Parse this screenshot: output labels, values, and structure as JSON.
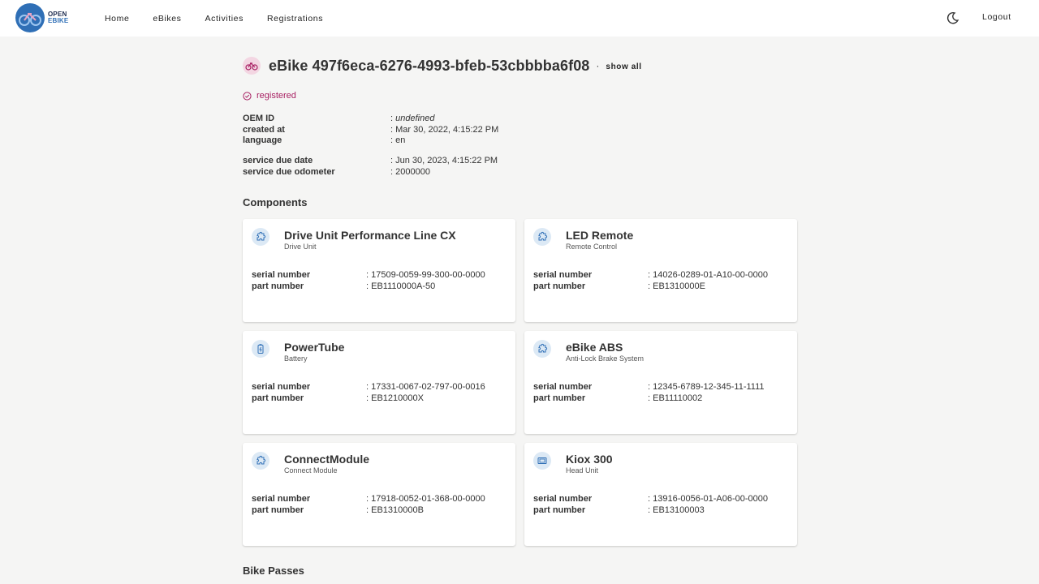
{
  "brand": {
    "line1": "OPEN",
    "line2": "EBIKE"
  },
  "nav": {
    "items": [
      {
        "label": "Home"
      },
      {
        "label": "eBikes"
      },
      {
        "label": "Activities"
      },
      {
        "label": "Registrations"
      }
    ]
  },
  "header": {
    "logout": "Logout"
  },
  "ebike": {
    "title": "eBike 497f6eca-6276-4993-bfeb-53cbbbba6f08",
    "separator": "·",
    "show_all": "show all",
    "status": "registered",
    "props1": [
      {
        "key": "OEM ID",
        "value": ": undefined"
      },
      {
        "key": "created at",
        "value": ": Mar 30, 2022, 4:15:22 PM"
      },
      {
        "key": "language",
        "value": ": en"
      }
    ],
    "props2": [
      {
        "key": "service due date",
        "value": ": Jun 30, 2023, 4:15:22 PM"
      },
      {
        "key": "service due odometer",
        "value": ": 2000000"
      }
    ]
  },
  "components_title": "Components",
  "components": [
    {
      "name": "Drive Unit Performance Line CX",
      "type": "Drive Unit",
      "icon": "puzzle-icon",
      "serial_label": "serial number",
      "serial": ": 17509-0059-99-300-00-0000",
      "part_label": "part number",
      "part": ": EB1110000A-50"
    },
    {
      "name": "LED Remote",
      "type": "Remote Control",
      "icon": "puzzle-icon",
      "serial_label": "serial number",
      "serial": ": 14026-0289-01-A10-00-0000",
      "part_label": "part number",
      "part": ": EB1310000E"
    },
    {
      "name": "PowerTube",
      "type": "Battery",
      "icon": "battery-icon",
      "serial_label": "serial number",
      "serial": ": 17331-0067-02-797-00-0016",
      "part_label": "part number",
      "part": ": EB1210000X"
    },
    {
      "name": "eBike ABS",
      "type": "Anti-Lock Brake System",
      "icon": "puzzle-icon",
      "serial_label": "serial number",
      "serial": ": 12345-6789-12-345-11-1111",
      "part_label": "part number",
      "part": ": EB11110002"
    },
    {
      "name": "ConnectModule",
      "type": "Connect Module",
      "icon": "puzzle-icon",
      "serial_label": "serial number",
      "serial": ": 17918-0052-01-368-00-0000",
      "part_label": "part number",
      "part": ": EB1310000B"
    },
    {
      "name": "Kiox 300",
      "type": "Head Unit",
      "icon": "display-icon",
      "serial_label": "serial number",
      "serial": ": 13916-0056-01-A06-00-0000",
      "part_label": "part number",
      "part": ": EB13100003"
    }
  ],
  "bike_passes_title": "Bike Passes",
  "colors": {
    "accent": "#a81f62",
    "brand_blue": "#2f6fb6",
    "icon_bg": "#dce9f5"
  }
}
